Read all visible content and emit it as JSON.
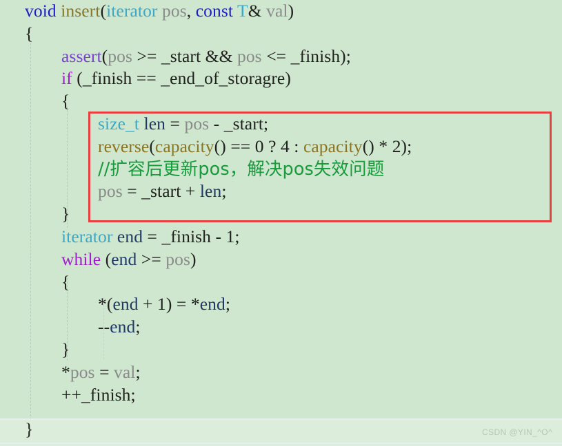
{
  "editor": {
    "background_color": "#cfe6cf",
    "bottom_band_color": "#dceddc",
    "highlight_box_color": "#e84040",
    "language": "C++",
    "code_lines": [
      {
        "indent": 0,
        "tokens": [
          {
            "t": "void",
            "c": "kw"
          },
          {
            "t": " ",
            "c": "plain"
          },
          {
            "t": "insert",
            "c": "fn"
          },
          {
            "t": "(",
            "c": "plain"
          },
          {
            "t": "iterator",
            "c": "type"
          },
          {
            "t": " ",
            "c": "plain"
          },
          {
            "t": "pos",
            "c": "var"
          },
          {
            "t": ", ",
            "c": "plain"
          },
          {
            "t": "const",
            "c": "kw"
          },
          {
            "t": " ",
            "c": "plain"
          },
          {
            "t": "T",
            "c": "type"
          },
          {
            "t": "& ",
            "c": "plain"
          },
          {
            "t": "val",
            "c": "var"
          },
          {
            "t": ")",
            "c": "plain"
          }
        ]
      },
      {
        "indent": 0,
        "tokens": [
          {
            "t": "{",
            "c": "plain"
          }
        ]
      },
      {
        "indent": 1,
        "tokens": [
          {
            "t": "assert",
            "c": "macro"
          },
          {
            "t": "(",
            "c": "plain"
          },
          {
            "t": "pos",
            "c": "var"
          },
          {
            "t": " >= _start && ",
            "c": "plain"
          },
          {
            "t": "pos",
            "c": "var"
          },
          {
            "t": " <= _finish);",
            "c": "plain"
          }
        ]
      },
      {
        "indent": 1,
        "tokens": [
          {
            "t": "if",
            "c": "kw2"
          },
          {
            "t": " (_finish == _end_of_storagre)",
            "c": "plain"
          }
        ]
      },
      {
        "indent": 1,
        "tokens": [
          {
            "t": "{",
            "c": "plain"
          }
        ]
      },
      {
        "indent": 2,
        "tokens": [
          {
            "t": "size_t",
            "c": "type"
          },
          {
            "t": " ",
            "c": "plain"
          },
          {
            "t": "len",
            "c": "ident"
          },
          {
            "t": " = ",
            "c": "plain"
          },
          {
            "t": "pos",
            "c": "var"
          },
          {
            "t": " - _start;",
            "c": "plain"
          }
        ]
      },
      {
        "indent": 2,
        "tokens": [
          {
            "t": "reverse",
            "c": "fn"
          },
          {
            "t": "(",
            "c": "plain"
          },
          {
            "t": "capacity",
            "c": "fn"
          },
          {
            "t": "() == 0 ? 4 : ",
            "c": "plain"
          },
          {
            "t": "capacity",
            "c": "fn"
          },
          {
            "t": "() * 2);",
            "c": "plain"
          }
        ]
      },
      {
        "indent": 2,
        "tokens": [
          {
            "t": "//扩容后更新pos，解决pos失效问题",
            "c": "cmt"
          }
        ]
      },
      {
        "indent": 2,
        "tokens": [
          {
            "t": "pos",
            "c": "var"
          },
          {
            "t": " = _start + ",
            "c": "plain"
          },
          {
            "t": "len",
            "c": "ident"
          },
          {
            "t": ";",
            "c": "plain"
          }
        ]
      },
      {
        "indent": 1,
        "tokens": [
          {
            "t": "}",
            "c": "plain"
          }
        ]
      },
      {
        "indent": 1,
        "tokens": [
          {
            "t": "iterator",
            "c": "type"
          },
          {
            "t": " ",
            "c": "plain"
          },
          {
            "t": "end",
            "c": "ident"
          },
          {
            "t": " = _finish - 1;",
            "c": "plain"
          }
        ]
      },
      {
        "indent": 1,
        "tokens": [
          {
            "t": "while",
            "c": "kw2"
          },
          {
            "t": " (",
            "c": "plain"
          },
          {
            "t": "end",
            "c": "ident"
          },
          {
            "t": " >= ",
            "c": "plain"
          },
          {
            "t": "pos",
            "c": "var"
          },
          {
            "t": ")",
            "c": "plain"
          }
        ]
      },
      {
        "indent": 1,
        "tokens": [
          {
            "t": "{",
            "c": "plain"
          }
        ]
      },
      {
        "indent": 2,
        "tokens": [
          {
            "t": "*(",
            "c": "plain"
          },
          {
            "t": "end",
            "c": "ident"
          },
          {
            "t": " + 1) = *",
            "c": "plain"
          },
          {
            "t": "end",
            "c": "ident"
          },
          {
            "t": ";",
            "c": "plain"
          }
        ]
      },
      {
        "indent": 2,
        "tokens": [
          {
            "t": "--",
            "c": "plain"
          },
          {
            "t": "end",
            "c": "ident"
          },
          {
            "t": ";",
            "c": "plain"
          }
        ]
      },
      {
        "indent": 1,
        "tokens": [
          {
            "t": "}",
            "c": "plain"
          }
        ]
      },
      {
        "indent": 1,
        "tokens": [
          {
            "t": "*",
            "c": "plain"
          },
          {
            "t": "pos",
            "c": "var"
          },
          {
            "t": " = ",
            "c": "plain"
          },
          {
            "t": "val",
            "c": "var"
          },
          {
            "t": ";",
            "c": "plain"
          }
        ]
      },
      {
        "indent": 1,
        "tokens": [
          {
            "t": "++_finish;",
            "c": "plain"
          }
        ]
      }
    ],
    "closing_brace": "}",
    "watermark": "CSDN @YIN_^O^"
  }
}
